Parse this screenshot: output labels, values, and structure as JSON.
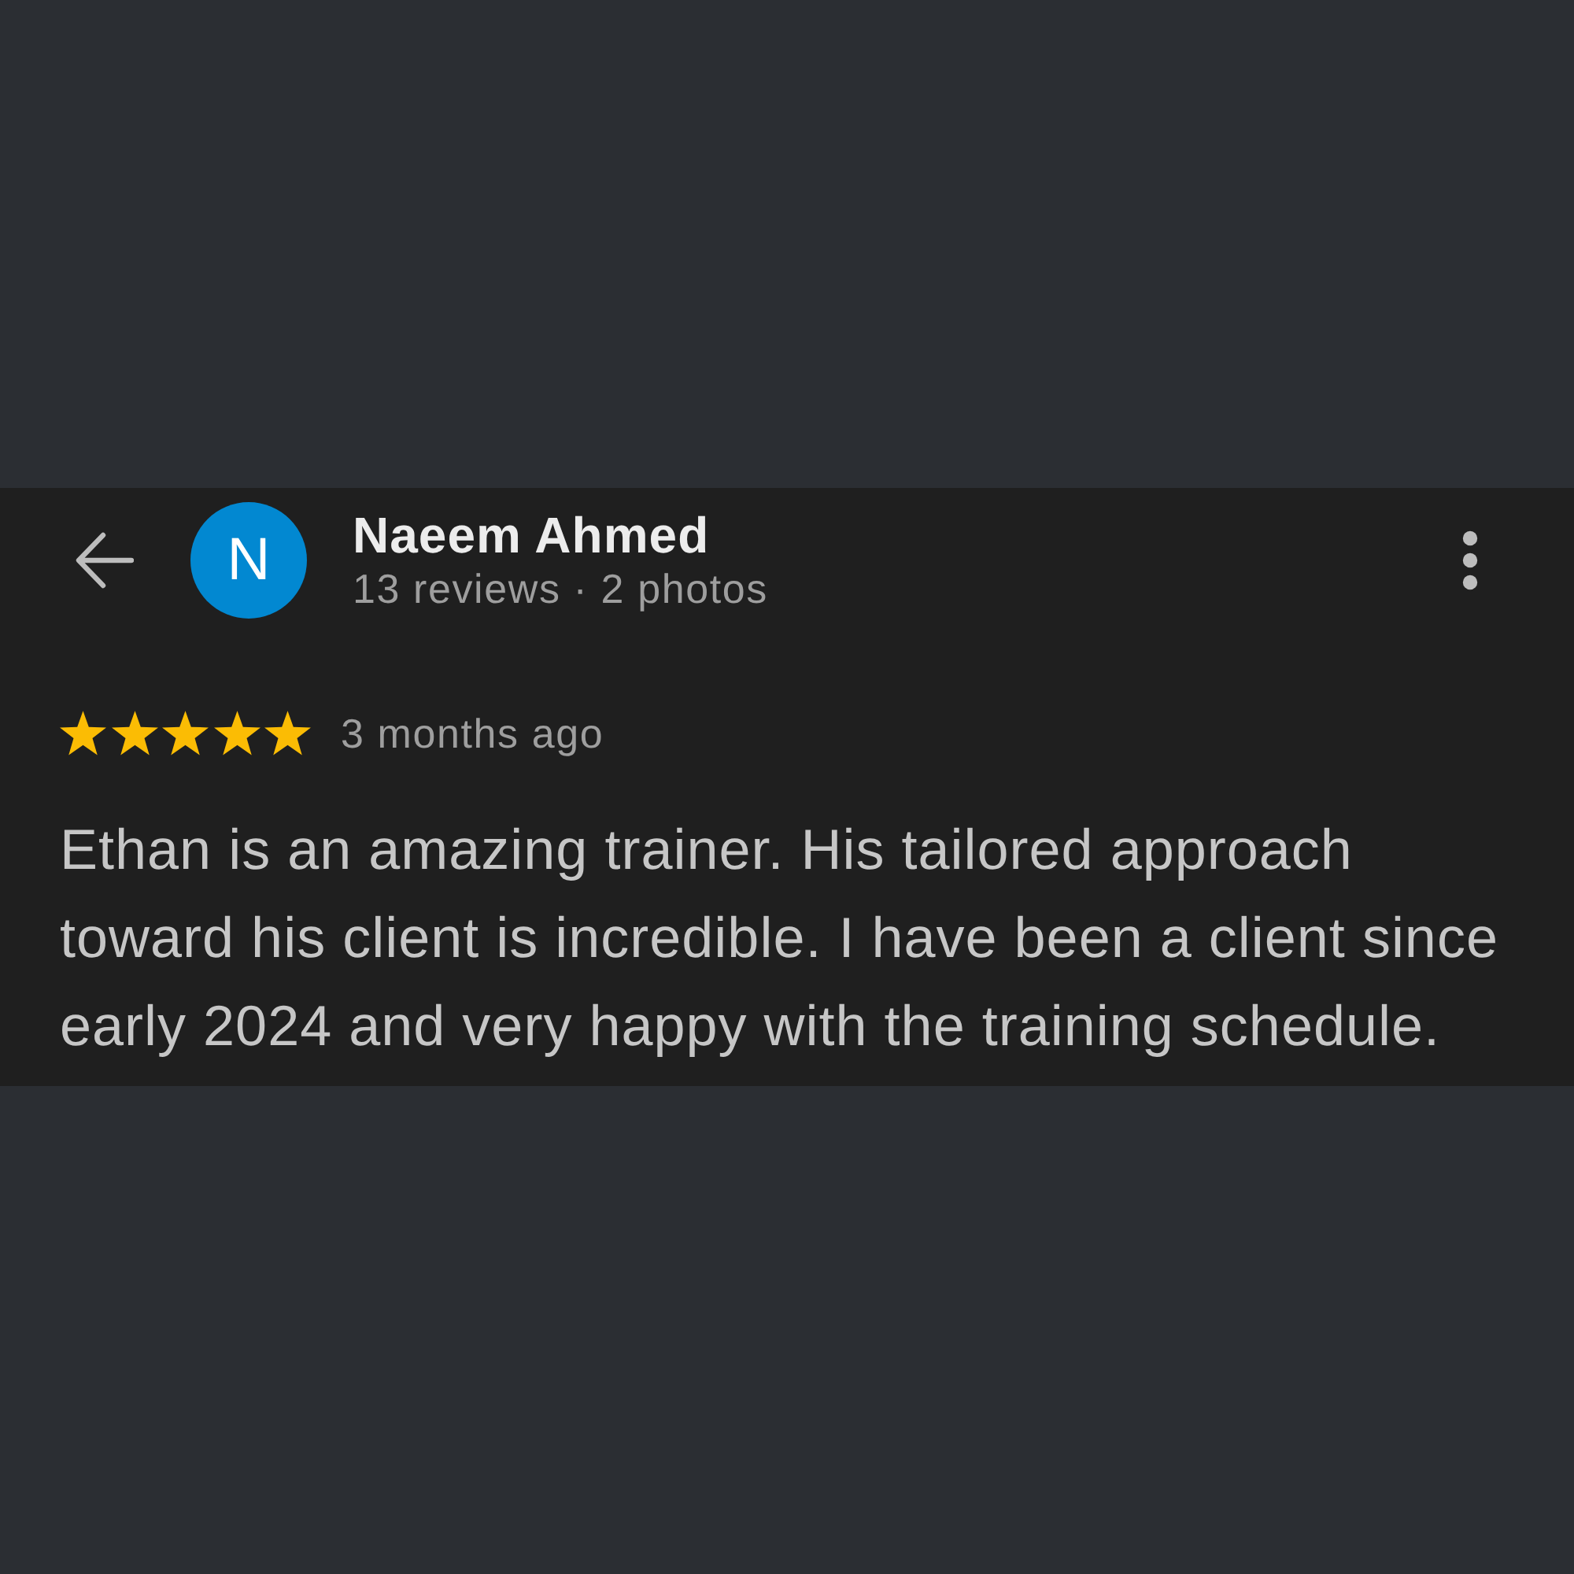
{
  "header": {
    "avatar_letter": "N",
    "name": "Naeem Ahmed",
    "subtitle": "13 reviews · 2 photos"
  },
  "review": {
    "stars": 5,
    "time": "3 months ago",
    "text": "Ethan is an amazing trainer. His tailored approach toward his client is incredible. I have been a client since early 2024 and very happy with the training schedule."
  }
}
